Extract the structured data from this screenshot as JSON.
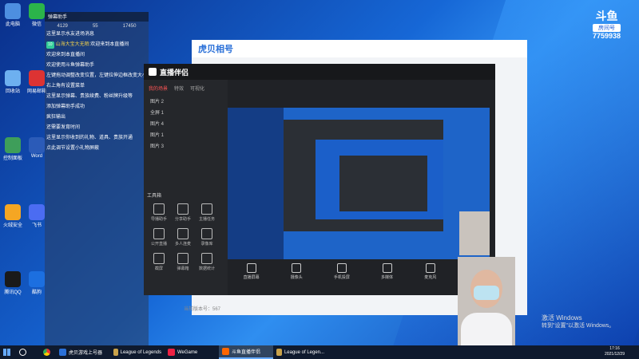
{
  "desktop": {
    "icons": [
      {
        "name": "此电脑",
        "color": "#4d8fe0"
      },
      {
        "name": "回收站",
        "color": "#6db0f0"
      },
      {
        "name": "控制面板",
        "color": "#3e9e5a"
      },
      {
        "name": "火绒安全",
        "color": "#f5a623"
      },
      {
        "name": "腾讯QQ",
        "color": "#1a1a1a"
      },
      {
        "name": "微信",
        "color": "#2bb44a"
      },
      {
        "name": "网易邮箱",
        "color": "#d33"
      },
      {
        "name": "Word",
        "color": "#2b5bb8"
      },
      {
        "name": "飞书",
        "color": "#4b6cf2"
      },
      {
        "name": "酷狗",
        "color": "#1c6fe0"
      }
    ]
  },
  "chat": {
    "window_title": "弹幕助手",
    "stats": [
      "4129",
      "55",
      "17450"
    ],
    "messages": [
      {
        "tag": "",
        "user": "",
        "text": "这里显示水友进场消息"
      },
      {
        "tag": "10",
        "user": "山海大宝大无陌:",
        "text": "欢迎来到本直播间"
      },
      {
        "tag": "",
        "user": "",
        "text": "欢迎来到本直播间"
      },
      {
        "tag": "",
        "user": "",
        "text": "欢迎使用斗鱼弹幕助手"
      },
      {
        "tag": "",
        "user": "",
        "text": "左键拖动调整改变位置，左键拉伸边框改变大小"
      },
      {
        "tag": "",
        "user": "",
        "text": "右上角有设置菜单"
      },
      {
        "tag": "",
        "user": "",
        "text": "这里显示弹幕、贵族续费、粉丝牌升级等"
      },
      {
        "tag": "",
        "user": "",
        "text": "添加弹幕助手成功"
      },
      {
        "tag": "",
        "user": "",
        "text": "疯狂输出"
      },
      {
        "tag": "",
        "user": "",
        "text": "还需要发育时间"
      },
      {
        "tag": "",
        "user": "",
        "text": "这里显示你收到的礼物、道具、贵族开通"
      },
      {
        "tag": "",
        "user": "",
        "text": "点此调节设置小礼物屏蔽"
      }
    ]
  },
  "browser": {
    "title": "虎贝相号"
  },
  "app": {
    "title": "直播伴侣",
    "tabs": [
      "我的场景",
      "特效",
      "可视化"
    ],
    "scenes": [
      "图片 2",
      "全屏 1",
      "图片 4",
      "图片 1",
      "图片 3"
    ],
    "tools_title": "工具箱",
    "tools": [
      "导播助手",
      "分享助手",
      "主播任务",
      "公开直播",
      "多人连麦",
      "录像库",
      "截屏",
      "弹幕箱",
      "数据统计"
    ],
    "bottom": [
      "直播屏幕",
      "摄像头",
      "手机投屏",
      "多媒体",
      "麦克风",
      "扬声器"
    ],
    "status": "当前版本号：567"
  },
  "watermark": {
    "logo": "斗鱼",
    "sub": "房间号",
    "room": "7759938"
  },
  "activate": {
    "line1": "激活 Windows",
    "line2": "转到\"设置\"以激活 Windows。"
  },
  "taskbar": {
    "items": [
      {
        "label": "虎贝游戏上号器",
        "color": "#2a70d8",
        "active": false
      },
      {
        "label": "League of Legends",
        "color": "#c9a24a",
        "active": false
      },
      {
        "label": "WeGame",
        "color": "#e24",
        "active": false
      },
      {
        "label": "斗鱼直播伴侣",
        "color": "#f60",
        "active": true
      },
      {
        "label": "League of Legen...",
        "color": "#c9a24a",
        "active": false
      }
    ],
    "time": "17:16",
    "date": "2021/12/29"
  }
}
